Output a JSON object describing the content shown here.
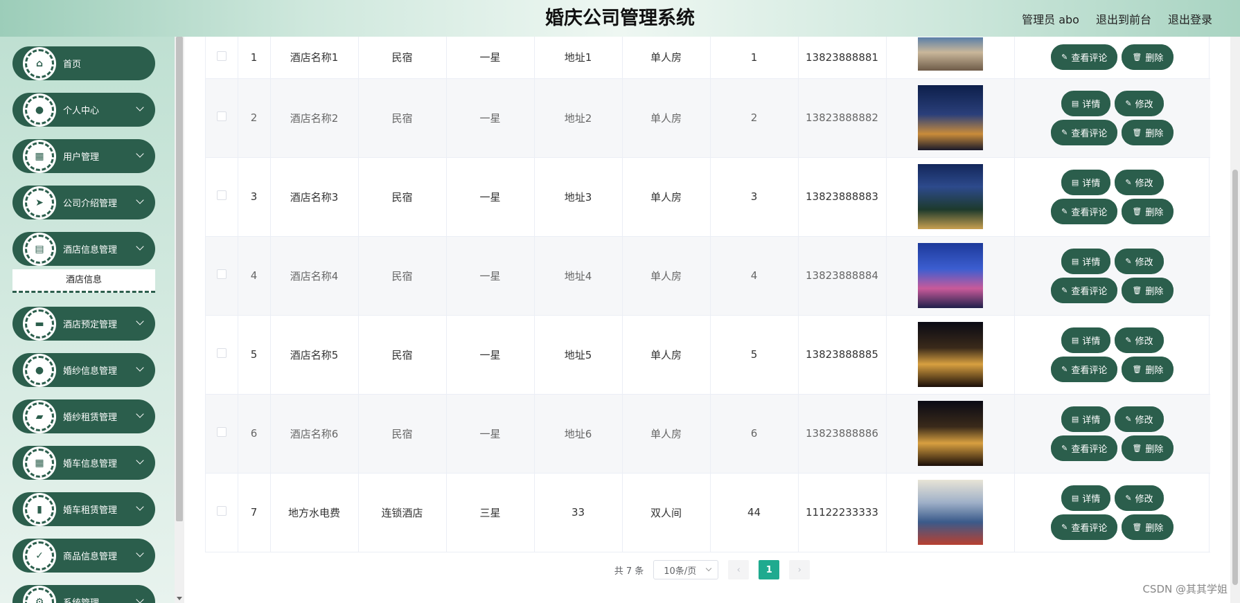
{
  "header": {
    "title": "婚庆公司管理系统",
    "user": "管理员 abo",
    "to_front": "退出到前台",
    "logout": "退出登录"
  },
  "sidebar": {
    "items": [
      {
        "label": "首页",
        "icon": "home-icon"
      },
      {
        "label": "个人中心",
        "icon": "user-icon"
      },
      {
        "label": "用户管理",
        "icon": "grid-icon"
      },
      {
        "label": "公司介绍管理",
        "icon": "send-icon"
      },
      {
        "label": "酒店信息管理",
        "icon": "clipboard-icon"
      },
      {
        "label": "酒店预定管理",
        "icon": "briefcase-icon"
      },
      {
        "label": "婚纱信息管理",
        "icon": "location-icon"
      },
      {
        "label": "婚纱租赁管理",
        "icon": "wallet-icon"
      },
      {
        "label": "婚车信息管理",
        "icon": "grid-icon"
      },
      {
        "label": "婚车租赁管理",
        "icon": "book-icon"
      },
      {
        "label": "商品信息管理",
        "icon": "checklist-icon"
      },
      {
        "label": "系统管理",
        "icon": "gear-icon"
      }
    ],
    "submenu": "酒店信息"
  },
  "table": {
    "rows": [
      {
        "idx": "1",
        "name": "酒店名称1",
        "type": "民宿",
        "star": "一星",
        "address": "地址1",
        "room": "单人房",
        "num": "1",
        "phone": "13823888881"
      },
      {
        "idx": "2",
        "name": "酒店名称2",
        "type": "民宿",
        "star": "一星",
        "address": "地址2",
        "room": "单人房",
        "num": "2",
        "phone": "13823888882"
      },
      {
        "idx": "3",
        "name": "酒店名称3",
        "type": "民宿",
        "star": "一星",
        "address": "地址3",
        "room": "单人房",
        "num": "3",
        "phone": "13823888883"
      },
      {
        "idx": "4",
        "name": "酒店名称4",
        "type": "民宿",
        "star": "一星",
        "address": "地址4",
        "room": "单人房",
        "num": "4",
        "phone": "13823888884"
      },
      {
        "idx": "5",
        "name": "酒店名称5",
        "type": "民宿",
        "star": "一星",
        "address": "地址5",
        "room": "单人房",
        "num": "5",
        "phone": "13823888885"
      },
      {
        "idx": "6",
        "name": "酒店名称6",
        "type": "民宿",
        "star": "一星",
        "address": "地址6",
        "room": "单人房",
        "num": "6",
        "phone": "13823888886"
      },
      {
        "idx": "7",
        "name": "地方水电费",
        "type": "连锁酒店",
        "star": "三星",
        "address": "33",
        "room": "双人间",
        "num": "44",
        "phone": "11122233333"
      }
    ],
    "actions": {
      "detail": "详情",
      "edit": "修改",
      "review": "查看评论",
      "delete": "删除"
    }
  },
  "pager": {
    "total": "共 7 条",
    "page_size": "10条/页",
    "current_page": "1"
  },
  "watermark": "CSDN @其其学姐",
  "colors": {
    "menu_bg": "#2b5e4c",
    "page_active": "#1faa8f"
  }
}
